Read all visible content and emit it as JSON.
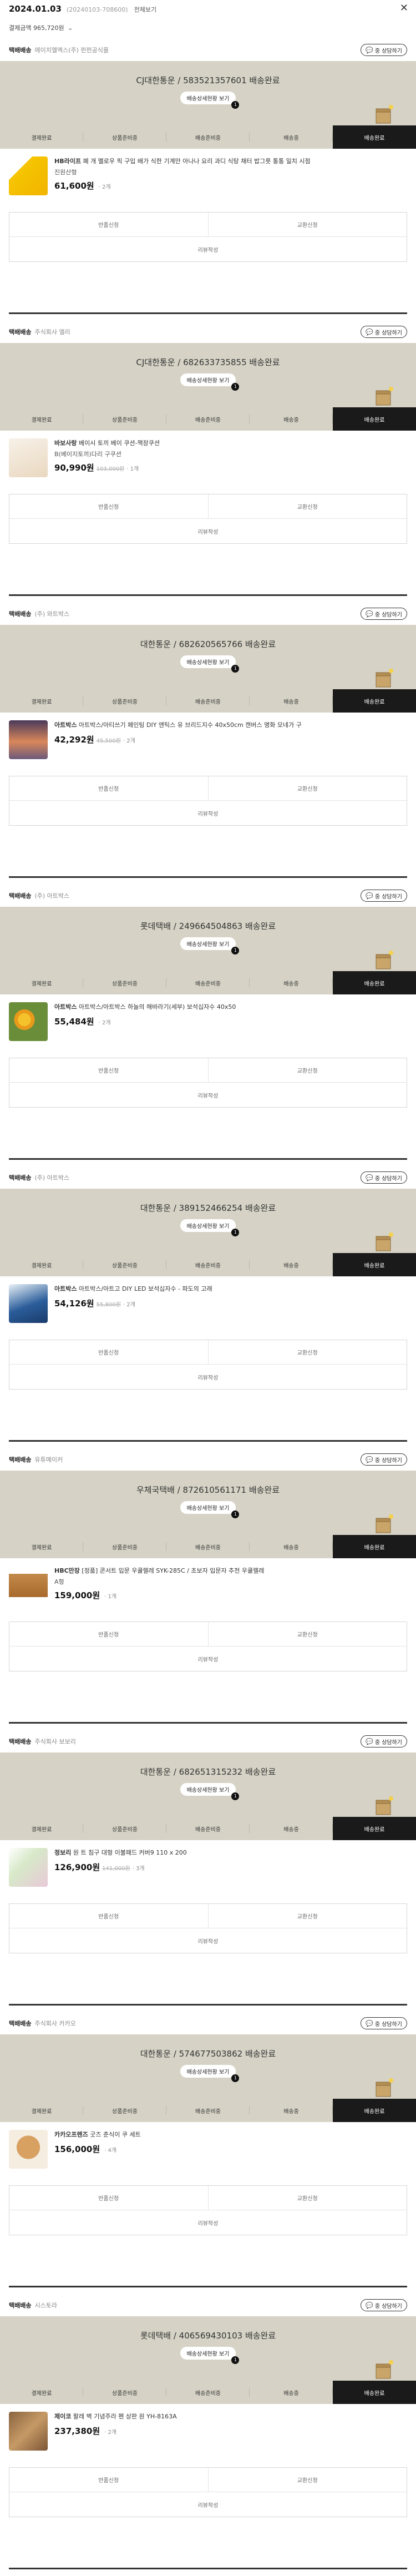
{
  "header": {
    "date": "2024.01.03",
    "order_code": "(20240103-708600)",
    "full_view": "전체보기",
    "close": "✕"
  },
  "summary": {
    "text": "결제금액 965,720원",
    "icon": "chevron-down"
  },
  "labels": {
    "delivery": "택배배송",
    "inquiry": "중 상담하기",
    "detail": "배송상세현황 보기",
    "badge": "1",
    "exchange": "반품신청",
    "return": "교환신청",
    "review": "리뷰작성"
  },
  "steps": [
    "결제완료",
    "상품준비중",
    "배송준비중",
    "배송중",
    "배송완료"
  ],
  "shipments": [
    {
      "seller": "에이치엘엑스(주) 펀펀공식몰",
      "tracking": "CJ대한통운 / 583521357601 배송완료",
      "product": {
        "brand": "HB라이프",
        "name": "폐 개 멜로우 픽 구입 배가 식한 기계만 아나나 요리 과디 식탕 채터 밥그릇 통통 일치 시점",
        "option": "진원산형",
        "price": "61,600",
        "orig": "",
        "qty": "2개"
      },
      "thumb": "yellow"
    },
    {
      "seller": "주식회사 엘리",
      "tracking": "CJ대한통운 / 682633735855 배송완료",
      "product": {
        "brand": "바보사랑",
        "name": "베이시 토끼 베이 쿠션-책장쿠션",
        "option": "B(베이지토끼)다리 구쿠션",
        "price": "90,990",
        "orig": "103,000원",
        "qty": "1개"
      },
      "thumb": "beige"
    },
    {
      "seller": "(주) 와트박스",
      "tracking": "대한통운 / 682620565766 배송완료",
      "product": {
        "brand": "아트박스",
        "name": "아트박스/아티쓰기 페인팅 DIY 엔틱스 유 브리드지수 40x50cm 캔버스 명화 모네가 구",
        "option": "",
        "price": "42,292",
        "orig": "45,500원",
        "qty": "2개"
      },
      "thumb": "painting"
    },
    {
      "seller": "(주) 아트박스",
      "tracking": "롯데택배 / 249664504863 배송완료",
      "product": {
        "brand": "아트박스",
        "name": "아트박스/아트박스 하늘의 해바라기(세부) 보석십자수 40x50",
        "option": "",
        "price": "55,484",
        "orig": "",
        "qty": "2개"
      },
      "thumb": "sunflower"
    },
    {
      "seller": "(주) 아트박스",
      "tracking": "대한통운 / 389152466254 배송완료",
      "product": {
        "brand": "아트박스",
        "name": "아트박스/아트고 DIY LED 보석십자수 - 파도의 고래",
        "option": "",
        "price": "54,126",
        "orig": "55,800원",
        "qty": "2개"
      },
      "thumb": "wave"
    },
    {
      "seller": "유튜메이커",
      "tracking": "우체국택배 / 872610561171 배송완료",
      "product": {
        "brand": "HBC만장",
        "name": "[정품] 콘서트 입문 우쿨렐레 SYK-285C / 초보자 입문자 추천 우쿨렐레",
        "option": "A형",
        "price": "159,000",
        "orig": "",
        "qty": "1개"
      },
      "thumb": "ukulele"
    },
    {
      "seller": "주식회사 보보리",
      "tracking": "대한통운 / 682651315232 배송완료",
      "product": {
        "brand": "정보리",
        "name": "원 트 침구 대형 이불패드 커버9 110 x 200",
        "option": "",
        "price": "126,900",
        "orig": "141,000원",
        "qty": "3개"
      },
      "thumb": "bedding"
    },
    {
      "seller": "주식회사 카카오",
      "tracking": "대한통운 / 574677503862 배송완료",
      "product": {
        "brand": "카카오프렌즈",
        "name": "굿즈 춘식이 쿠 세트",
        "option": "",
        "price": "156,000",
        "orig": "",
        "qty": "4개"
      },
      "thumb": "plush"
    },
    {
      "seller": "시스토라",
      "tracking": "롯데택배 / 406569430103 배송완료",
      "product": {
        "brand": "제이코",
        "name": "팔레 벽 기념주라 펜 상판 원 YH-8163A",
        "option": "",
        "price": "237,380",
        "orig": "",
        "qty": "2개"
      },
      "thumb": "wood"
    }
  ],
  "colors": {
    "band": "#d6d3c6",
    "active": "#1a1a1a"
  }
}
